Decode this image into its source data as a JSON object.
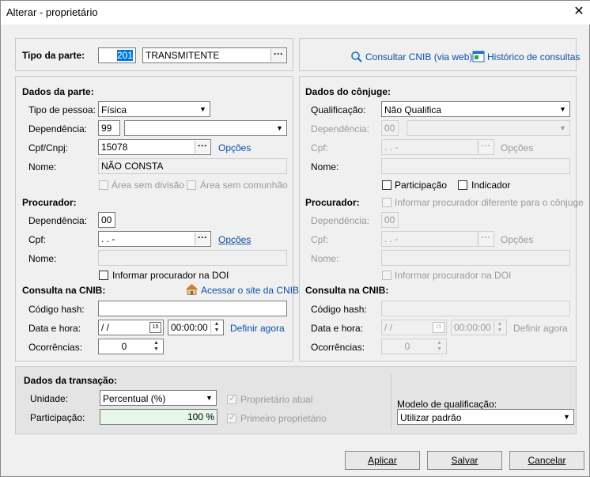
{
  "window": {
    "title": "Alterar - proprietário",
    "close": "✕"
  },
  "tipo": {
    "label": "Tipo da parte:",
    "code": "201",
    "value": "TRANSMITENTE",
    "ellipsis": "···"
  },
  "links_top": {
    "cnib": "Consultar CNIB (via web)",
    "historico": "Histórico de consultas"
  },
  "parte": {
    "title": "Dados da parte:",
    "tipo_pessoa_label": "Tipo de pessoa:",
    "tipo_pessoa": "Física",
    "dependencia_label": "Dependência:",
    "dependencia_code": "99",
    "dependencia_value": "",
    "cpf_label": "Cpf/Cnpj:",
    "cpf": "15078",
    "opcoes": "Opções",
    "nome_label": "Nome:",
    "nome": "NÃO CONSTA",
    "area_sem_divisao": "Área sem divisão",
    "area_sem_comunhao": "Área sem comunhão"
  },
  "procurador": {
    "title": "Procurador:",
    "dependencia_label": "Dependência:",
    "dependencia": "00",
    "cpf_label": "Cpf:",
    "cpf": " .  .  -",
    "opcoes": "Opções",
    "nome_label": "Nome:",
    "nome": "",
    "informar_doi": "Informar procurador na DOI"
  },
  "cnib": {
    "title": "Consulta na CNIB:",
    "acessar": "Acessar o site da CNIB",
    "hash_label": "Código hash:",
    "hash": "",
    "data_label": "Data e hora:",
    "data": " / /",
    "hora": "00:00:00",
    "definir": "Definir agora",
    "ocorrencias_label": "Ocorrências:",
    "ocorrencias": "0"
  },
  "conjuge": {
    "title": "Dados do cônjuge:",
    "qualificacao_label": "Qualificação:",
    "qualificacao": "Não Qualifica",
    "dependencia_label": "Dependência:",
    "dependencia": "00",
    "cpf_label": "Cpf:",
    "cpf": " .  .  -",
    "opcoes": "Opções",
    "nome_label": "Nome:",
    "participacao": "Participação",
    "indicador": "Indicador"
  },
  "procurador_conjuge": {
    "title": "Procurador:",
    "informar_diferente": "Informar procurador diferente para o cônjuge",
    "dependencia_label": "Dependência:",
    "dependencia": "00",
    "cpf_label": "Cpf:",
    "cpf": " .  .  -",
    "opcoes": "Opções",
    "nome_label": "Nome:",
    "informar_doi": "Informar procurador na DOI"
  },
  "cnib_conjuge": {
    "title": "Consulta na CNIB:",
    "hash_label": "Código hash:",
    "data_label": "Data e hora:",
    "data": " / /",
    "hora": "00:00:00",
    "definir": "Definir agora",
    "ocorrencias_label": "Ocorrências:",
    "ocorrencias": "0"
  },
  "transacao": {
    "title": "Dados da transação:",
    "unidade_label": "Unidade:",
    "unidade": "Percentual (%)",
    "participacao_label": "Participação:",
    "participacao": "100 %",
    "proprietario_atual": "Proprietário atual",
    "primeiro_proprietario": "Primeiro proprietário",
    "modelo_label": "Modelo de qualificação:",
    "modelo": "Utilizar padrão"
  },
  "buttons": {
    "aplicar": "Aplicar",
    "salvar": "Salvar",
    "cancelar": "Cancelar"
  },
  "colors": {
    "link": "#0b4fa8",
    "highlight": "#0078d7",
    "participacao_bg": "#e6f6ea"
  },
  "icons": [
    "search-icon",
    "history-icon",
    "house-icon",
    "calendar-icon",
    "spinner-icon",
    "close-icon"
  ]
}
